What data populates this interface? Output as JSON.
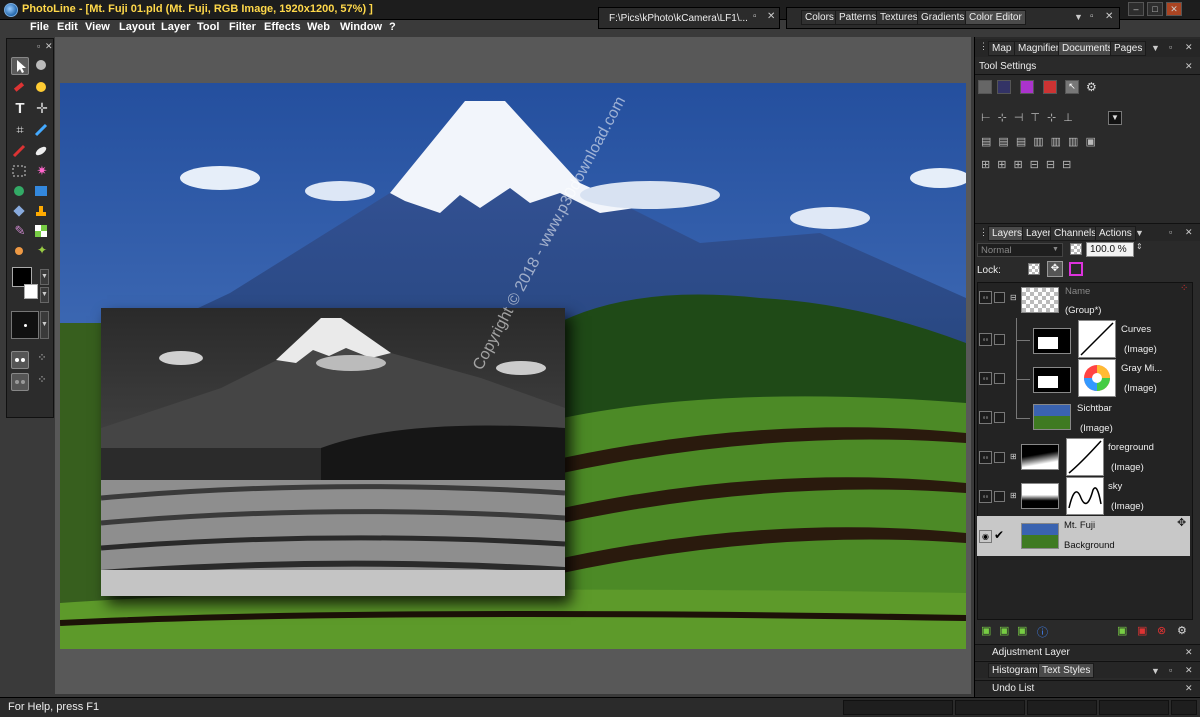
{
  "app": {
    "title": "PhotoLine - [Mt. Fuji 01.pld (Mt. Fuji, RGB Image, 1920x1200, 57%) ]"
  },
  "menu": {
    "items": [
      "File",
      "Edit",
      "View",
      "Layout",
      "Layer",
      "Tool",
      "Filter",
      "Effects",
      "Web",
      "Window",
      "?"
    ]
  },
  "top_panels": {
    "path": "F:\\Pics\\kPhoto\\kCamera\\LF1\\...",
    "tabs": [
      "Colors",
      "Patterns",
      "Textures",
      "Gradients",
      "Color Editor"
    ]
  },
  "right_panel": {
    "top_tabs": [
      "Map",
      "Magnifier",
      "Documents",
      "Pages"
    ],
    "tool_settings_title": "Tool Settings",
    "layers_tabs": [
      "Layers",
      "Layer",
      "Channels",
      "Actions"
    ],
    "blend_mode": "Normal",
    "opacity": "100.0 %",
    "lock_label": "Lock:",
    "adjustment_layer": "Adjustment Layer",
    "bottom_tabs": [
      "Histogram",
      "Text Styles"
    ],
    "undo_list": "Undo List"
  },
  "layers": [
    {
      "name": "Name",
      "sub": "(Group*)"
    },
    {
      "name": "Curves",
      "sub": "(Image)"
    },
    {
      "name": "Gray Mi...",
      "sub": "(Image)"
    },
    {
      "name": "Sichtbar",
      "sub": "(Image)"
    },
    {
      "name": "foreground",
      "sub": "(Image)"
    },
    {
      "name": "sky",
      "sub": "(Image)"
    },
    {
      "name": "Mt. Fuji",
      "sub": "Background"
    }
  ],
  "canvas": {
    "watermark": "Copyright © 2018 - www.p30download.com"
  },
  "status": {
    "text": "For Help, press F1"
  },
  "colors": {
    "title": "#ffd84a",
    "panel": "#2a2a2a",
    "selected_layer": "#c8c8c8"
  }
}
